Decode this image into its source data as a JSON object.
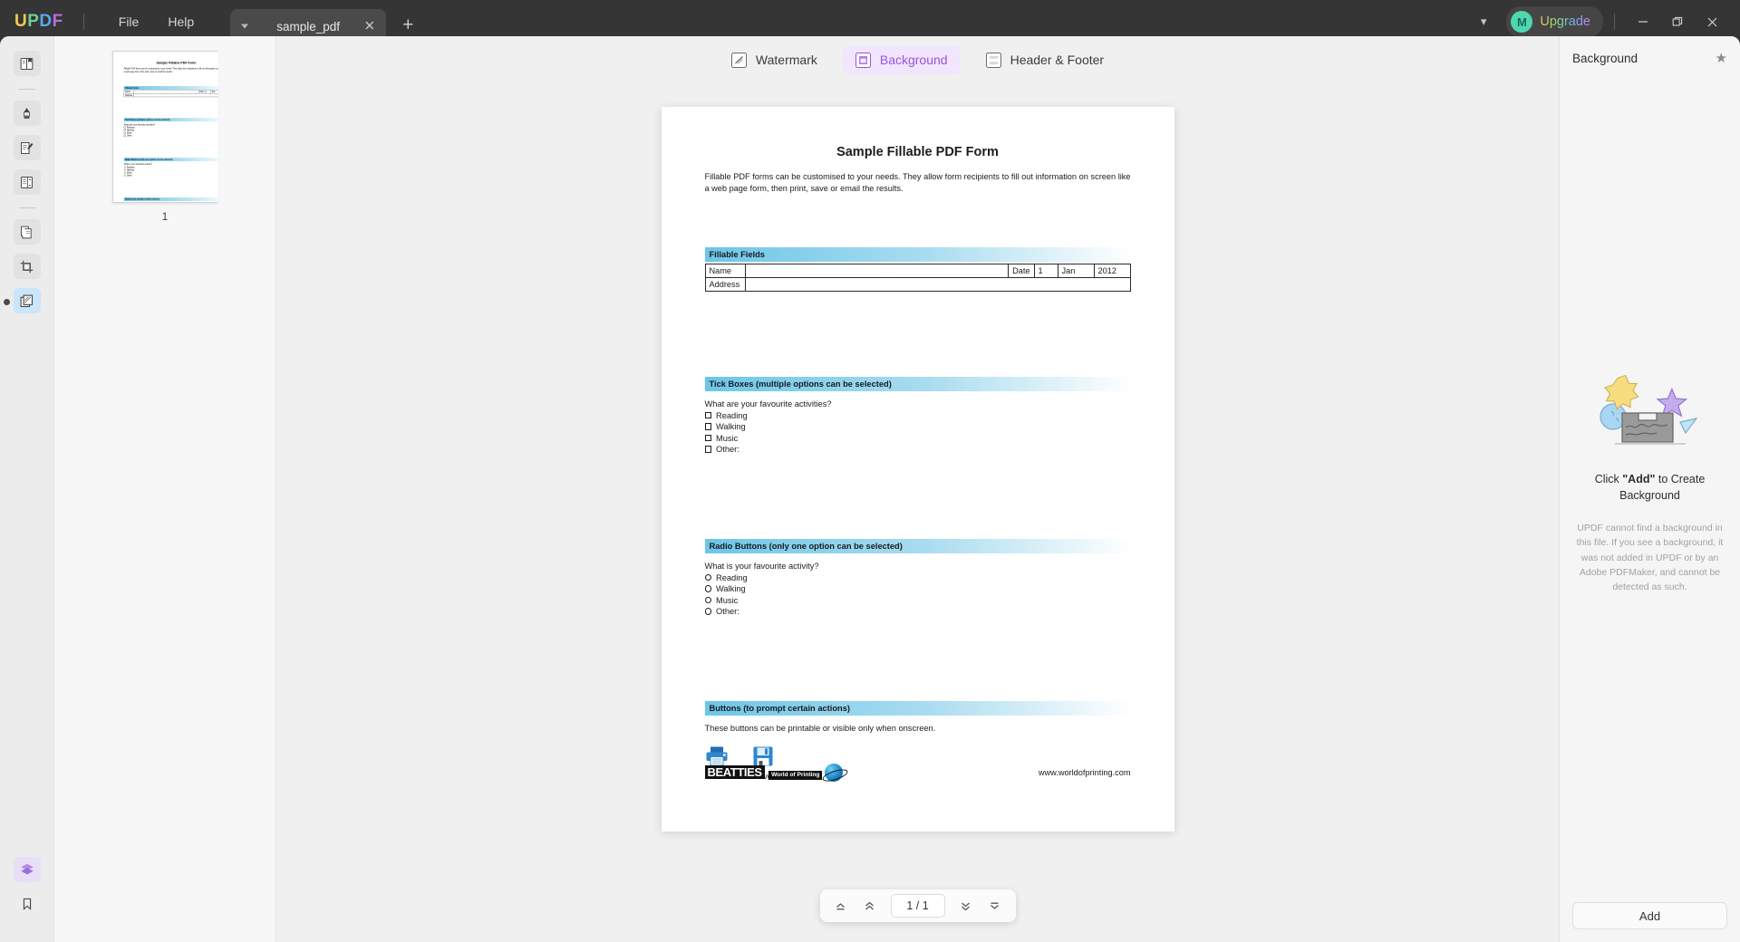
{
  "app": {
    "logo_letters": [
      "U",
      "P",
      "D",
      "F"
    ],
    "menus": [
      "File",
      "Help"
    ],
    "tab": {
      "title": "sample_pdf",
      "close_label": "✕",
      "add_label": "+"
    },
    "account": {
      "avatar_initial": "M",
      "upgrade_label": "Upgrade"
    },
    "window_controls": {
      "minimize": "—",
      "maximize": "❐",
      "close": "✕"
    },
    "accent_purple": "#9b51e0",
    "accent_blue": "#56a8f5"
  },
  "rail": {
    "items": [
      {
        "name": "reader-icon",
        "title": "Reader"
      },
      {
        "name": "highlighter-icon",
        "title": "Annotate"
      },
      {
        "name": "edit-pdf-icon",
        "title": "Edit PDF"
      },
      {
        "name": "page-layout-icon",
        "title": "Organize Pages"
      },
      {
        "name": "convert-icon",
        "title": "Convert"
      },
      {
        "name": "crop-icon",
        "title": "Crop"
      },
      {
        "name": "background-tools-icon",
        "title": "Page Tools"
      }
    ],
    "bottom": [
      {
        "name": "layers-icon",
        "title": "Layers"
      },
      {
        "name": "bookmark-icon",
        "title": "Bookmarks"
      }
    ]
  },
  "thumbnails": {
    "pages": [
      {
        "label": "1"
      }
    ]
  },
  "toolbar": {
    "tools": [
      {
        "label": "Watermark",
        "icon": "watermark-icon",
        "active": false
      },
      {
        "label": "Background",
        "icon": "background-icon",
        "active": true
      },
      {
        "label": "Header & Footer",
        "icon": "header-footer-icon",
        "active": false
      }
    ]
  },
  "pdf": {
    "title": "Sample Fillable PDF Form",
    "intro": "Fillable PDF forms can be customised to your needs. They allow form recipients to fill out information on screen like a web page form, then print, save or email the results.",
    "section_fillable": {
      "heading": "Fillable Fields",
      "rows": [
        {
          "label": "Name",
          "value": ""
        },
        {
          "label": "Address",
          "value": ""
        }
      ],
      "date_label": "Date",
      "date_day": "1",
      "date_month": "Jan",
      "date_year": "2012"
    },
    "section_tick": {
      "heading": "Tick Boxes (multiple options can be selected)",
      "question": "What are your favourite activities?",
      "options": [
        "Reading",
        "Walking",
        "Music",
        "Other:"
      ]
    },
    "section_radio": {
      "heading": "Radio Buttons (only one option can be selected)",
      "question": "What is your favourite activity?",
      "options": [
        "Reading",
        "Walking",
        "Music",
        "Other:"
      ]
    },
    "section_buttons": {
      "heading": "Buttons (to prompt certain actions)",
      "description": "These buttons can be printable or visible only when onscreen.",
      "buttons": [
        {
          "label": "Print",
          "icon": "printer-icon"
        },
        {
          "label": "Save",
          "icon": "floppy-disk-icon"
        }
      ]
    },
    "footer": {
      "brand_main": "BEATTIES",
      "brand_sub": "World of Printing",
      "website": "www.worldofprinting.com"
    }
  },
  "pagenav": {
    "first_label": "⤒",
    "prev_label": "«",
    "current": "1 / 1",
    "next_label": "»",
    "last_label": "⤓"
  },
  "right_panel": {
    "title": "Background",
    "star_icon": "star-icon",
    "cta_prefix": "Click ",
    "cta_bold": "\"Add\"",
    "cta_suffix": " to Create Background",
    "note": "UPDF cannot find a background in this file. If you see a background, it was not added in UPDF or by an Adobe PDFMaker, and cannot be detected as such.",
    "add_label": "Add"
  }
}
